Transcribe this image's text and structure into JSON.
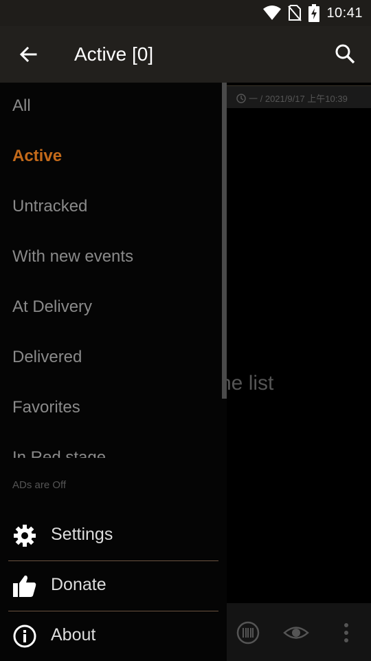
{
  "status_bar": {
    "time": "10:41",
    "icons": [
      "wifi-icon",
      "no-sim-icon",
      "battery-charging-icon"
    ]
  },
  "app_bar": {
    "title": "Active [0]",
    "back_icon": "arrow-left-icon",
    "search_icon": "search-icon"
  },
  "background_content": {
    "timestamp": "一 / 2021/9/17 上午10:39",
    "empty_text": "he list",
    "bottom_icons": [
      "barcode-scan-icon",
      "eye-icon",
      "more-vert-icon"
    ]
  },
  "drawer": {
    "filters": [
      {
        "label": "All",
        "active": false
      },
      {
        "label": "Active",
        "active": true
      },
      {
        "label": "Untracked",
        "active": false
      },
      {
        "label": "With new events",
        "active": false
      },
      {
        "label": "At Delivery",
        "active": false
      },
      {
        "label": "Delivered",
        "active": false
      },
      {
        "label": "Favorites",
        "active": false
      },
      {
        "label": "In Red stage",
        "active": false
      }
    ],
    "ads_note": "ADs are Off",
    "menu": [
      {
        "label": "Settings",
        "icon": "gear-icon"
      },
      {
        "label": "Donate",
        "icon": "thumbs-up-icon"
      },
      {
        "label": "About",
        "icon": "info-icon"
      }
    ]
  },
  "colors": {
    "accent": "#c46a1a",
    "appbar": "#22201d",
    "divider": "#6a5340"
  }
}
